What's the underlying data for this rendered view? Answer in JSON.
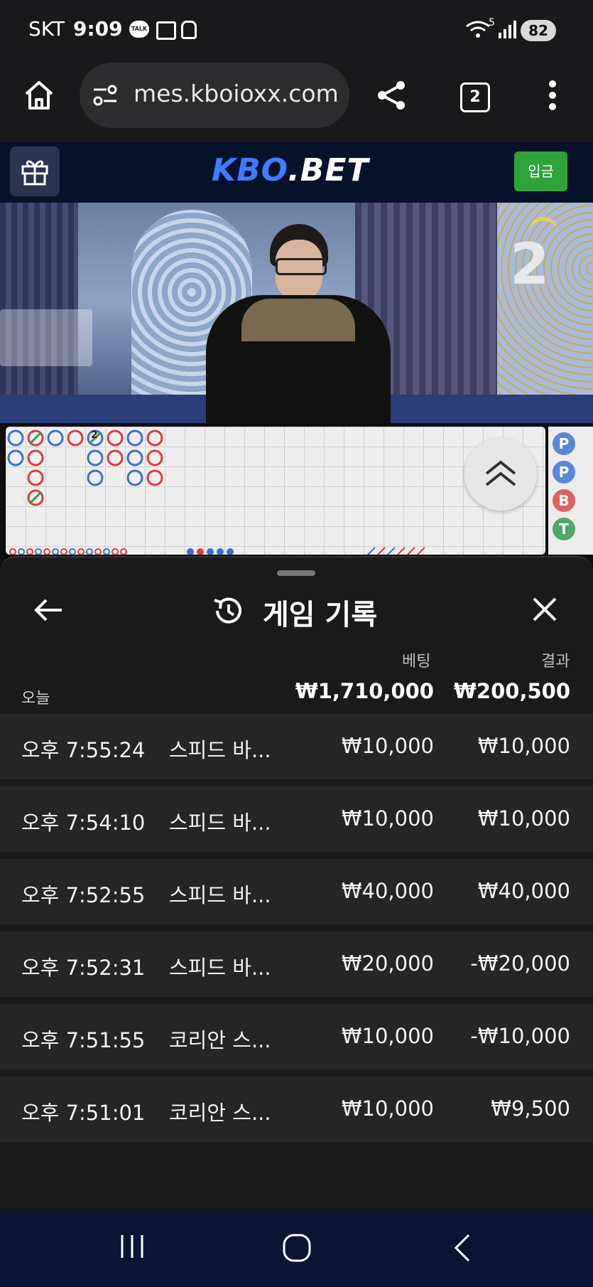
{
  "status_bar": {
    "carrier": "SKT",
    "time": "9:09",
    "battery": "82",
    "talk_badge": "TALK",
    "wifi_label": "5"
  },
  "browser": {
    "url": "mes.kboioxx.com",
    "tab_count": "2"
  },
  "site": {
    "logo_main": "KBO",
    "logo_suffix": ".BET",
    "deposit_label": "입금"
  },
  "video": {
    "round_number": "2"
  },
  "scoreboard": {
    "marker": "2",
    "side_beads": [
      "P",
      "P",
      "B",
      "T"
    ]
  },
  "history": {
    "title": "게임 기록",
    "col_bet": "베팅",
    "col_result": "결과",
    "today_label": "오늘",
    "total_bet": "₩1,710,000",
    "total_result": "₩200,500",
    "rows": [
      {
        "time": "오후 7:55:24",
        "game": "스피드 바...",
        "bet": "₩10,000",
        "result": "₩10,000"
      },
      {
        "time": "오후 7:54:10",
        "game": "스피드 바...",
        "bet": "₩10,000",
        "result": "₩10,000"
      },
      {
        "time": "오후 7:52:55",
        "game": "스피드 바...",
        "bet": "₩40,000",
        "result": "₩40,000"
      },
      {
        "time": "오후 7:52:31",
        "game": "스피드 바...",
        "bet": "₩20,000",
        "result": "-₩20,000"
      },
      {
        "time": "오후 7:51:55",
        "game": "코리안 스...",
        "bet": "₩10,000",
        "result": "-₩10,000"
      },
      {
        "time": "오후 7:51:01",
        "game": "코리안 스...",
        "bet": "₩10,000",
        "result": "₩9,500"
      }
    ]
  },
  "colors": {
    "banker": "#e0393e",
    "player": "#3b6fd6",
    "tie": "#2e9b4a",
    "deposit": "#2fa33a",
    "logo_blue": "#3f7cff"
  }
}
